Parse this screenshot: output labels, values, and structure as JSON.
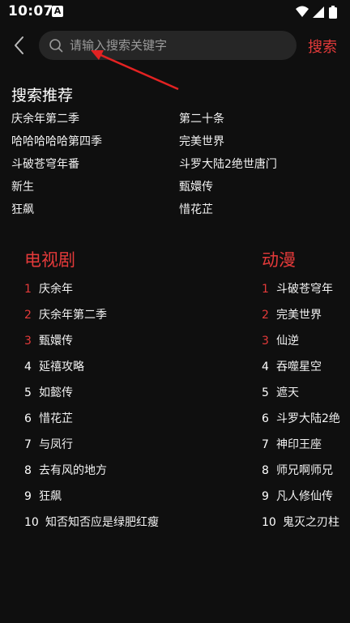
{
  "status_bar": {
    "time": "10:07",
    "notification_letter": "A",
    "icons": [
      "wifi-icon",
      "signal-icon",
      "battery-icon"
    ]
  },
  "search": {
    "placeholder": "请输入搜索关键字",
    "value": "",
    "submit_label": "搜索"
  },
  "colors": {
    "accent": "#e43a3a",
    "background": "#0f0f0f",
    "search_bg": "#262626"
  },
  "recommend": {
    "title": "搜索推荐",
    "items": [
      "庆余年第二季",
      "第二十条",
      "哈哈哈哈哈第四季",
      "完美世界",
      "斗破苍穹年番",
      "斗罗大陆2绝世唐门",
      "新生",
      "甄嬛传",
      "狂飙",
      "惜花芷"
    ]
  },
  "tv_ranking": {
    "title": "电视剧",
    "items": [
      {
        "rank": "1",
        "name": "庆余年"
      },
      {
        "rank": "2",
        "name": "庆余年第二季"
      },
      {
        "rank": "3",
        "name": "甄嬛传"
      },
      {
        "rank": "4",
        "name": "延禧攻略"
      },
      {
        "rank": "5",
        "name": "如懿传"
      },
      {
        "rank": "6",
        "name": "惜花芷"
      },
      {
        "rank": "7",
        "name": "与凤行"
      },
      {
        "rank": "8",
        "name": "去有风的地方"
      },
      {
        "rank": "9",
        "name": "狂飙"
      },
      {
        "rank": "10",
        "name": "知否知否应是绿肥红瘦"
      }
    ]
  },
  "anime_ranking": {
    "title": "动漫",
    "items": [
      {
        "rank": "1",
        "name": "斗破苍穹年"
      },
      {
        "rank": "2",
        "name": "完美世界"
      },
      {
        "rank": "3",
        "name": "仙逆"
      },
      {
        "rank": "4",
        "name": "吞噬星空"
      },
      {
        "rank": "5",
        "name": "遮天"
      },
      {
        "rank": "6",
        "name": "斗罗大陆2绝"
      },
      {
        "rank": "7",
        "name": "神印王座"
      },
      {
        "rank": "8",
        "name": "师兄啊师兄"
      },
      {
        "rank": "9",
        "name": "凡人修仙传"
      },
      {
        "rank": "10",
        "name": "鬼灭之刃柱"
      }
    ]
  }
}
